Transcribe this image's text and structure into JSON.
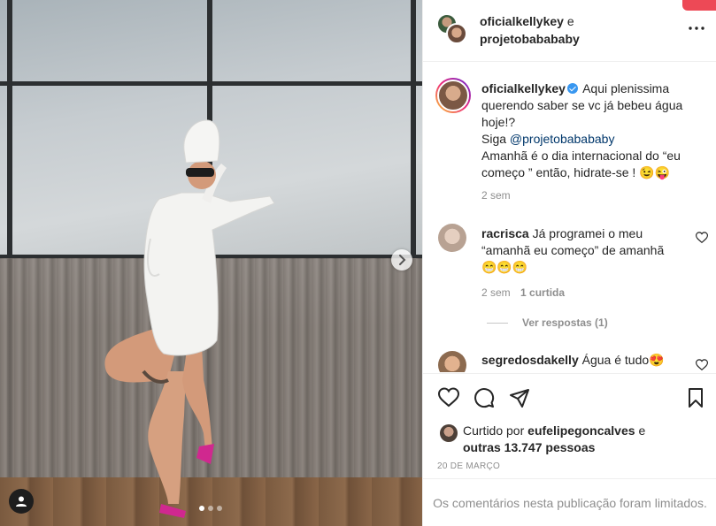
{
  "header": {
    "username": "oficialkellykey",
    "connector": "e",
    "partner": "projetobabababy"
  },
  "caption": {
    "username": "oficialkellykey",
    "line1": "Aqui plenissima",
    "line2": "querendo saber se vc já bebeu água",
    "line3": "hoje!?",
    "siga": "Siga",
    "mention": "@projetobabababy",
    "line5": "Amanhã é o dia internacional do “eu",
    "line6": "começo ” então, hidrate-se ! 😉😜",
    "time": "2 sem"
  },
  "comments": [
    {
      "username": "racrisca",
      "line1": "Já programei o meu",
      "line2": "“amanhã eu começo” de amanhã",
      "line3": "😁😁😁",
      "time": "2 sem",
      "likes": "1 curtida",
      "replies": "Ver respostas (1)"
    },
    {
      "username": "segredosdakelly",
      "line1": "Água é tudo😍"
    }
  ],
  "likes": {
    "prefix": "Curtido por",
    "user": "eufelipegoncalves",
    "connector": "e",
    "others": "outras 13.747 pessoas"
  },
  "date": "20 DE MARÇO",
  "comments_limited": "Os comentários nesta publicação foram limitados.",
  "carousel": {
    "total": 3,
    "active": 0
  },
  "colors": {
    "verified": "#3897f0",
    "mention": "#00376b",
    "muted": "#8e8e8e",
    "text": "#262626"
  }
}
